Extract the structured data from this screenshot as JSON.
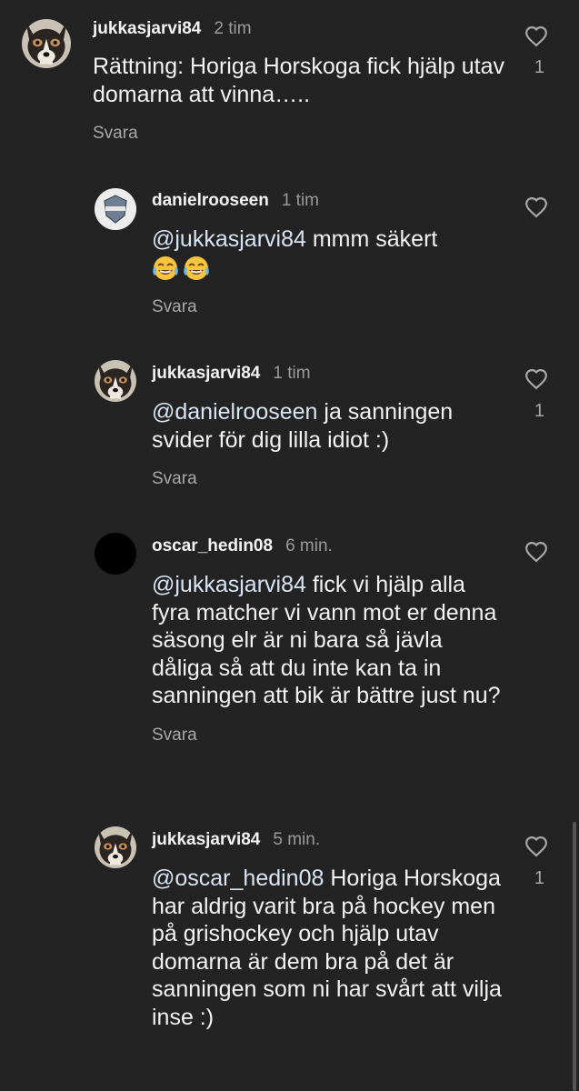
{
  "comments": [
    {
      "username": "jukkasjarvi84",
      "time": "2 tim",
      "text": "Rättning: Horiga Horskoga fick hjälp utav domarna att vinna…..",
      "reply": "Svara",
      "likes": "1",
      "avatar_icon": "husky-dog"
    },
    {
      "username": "danielrooseen",
      "time": "1 tim",
      "mention": "@jukkasjarvi84",
      "text": " mmm säkert",
      "emoji": [
        "face-with-tears-of-joy",
        "face-with-tears-of-joy"
      ],
      "reply": "Svara",
      "avatar_icon": "team-logo"
    },
    {
      "username": "jukkasjarvi84",
      "time": "1 tim",
      "mention": "@danielrooseen",
      "text": " ja sanningen svider för dig lilla idiot :)",
      "reply": "Svara",
      "likes": "1",
      "avatar_icon": "husky-dog"
    },
    {
      "username": "oscar_hedin08",
      "time": "6 min.",
      "mention": "@jukkasjarvi84",
      "text": " fick vi hjälp alla fyra matcher vi vann mot er denna säsong elr är ni bara så jävla dåliga så att du inte kan ta in sanningen att bik är bättre just nu?",
      "reply": "Svara",
      "avatar_icon": "black-circle"
    },
    {
      "username": "jukkasjarvi84",
      "time": "5 min.",
      "mention": "@oscar_hedin08",
      "text": " Horiga Horskoga har aldrig varit bra på hockey men på grishockey och hjälp utav domarna är dem bra på det är sanningen som ni har svårt att vilja inse :)",
      "likes": "1",
      "avatar_icon": "husky-dog"
    }
  ],
  "colors": {
    "background": "#232323",
    "text": "#f2f2f2",
    "secondary": "#9a9a9a",
    "mention": "#d7e4f4"
  }
}
